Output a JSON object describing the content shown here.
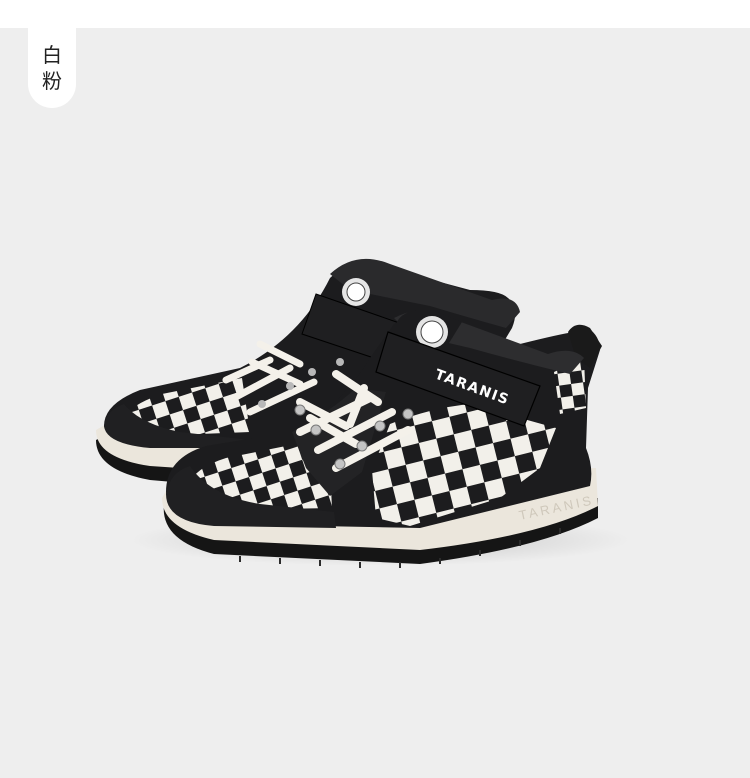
{
  "color_tag": {
    "line1": "白",
    "line2": "粉"
  },
  "product": {
    "brand_on_strap": "TARANIS",
    "brand_on_sole": "TARANIS"
  },
  "colors": {
    "background": "#eeeeee",
    "upper": "#1c1c1e",
    "check_light": "#f2f0ea",
    "sole": "#ebe6dc",
    "outsole": "#151515"
  }
}
